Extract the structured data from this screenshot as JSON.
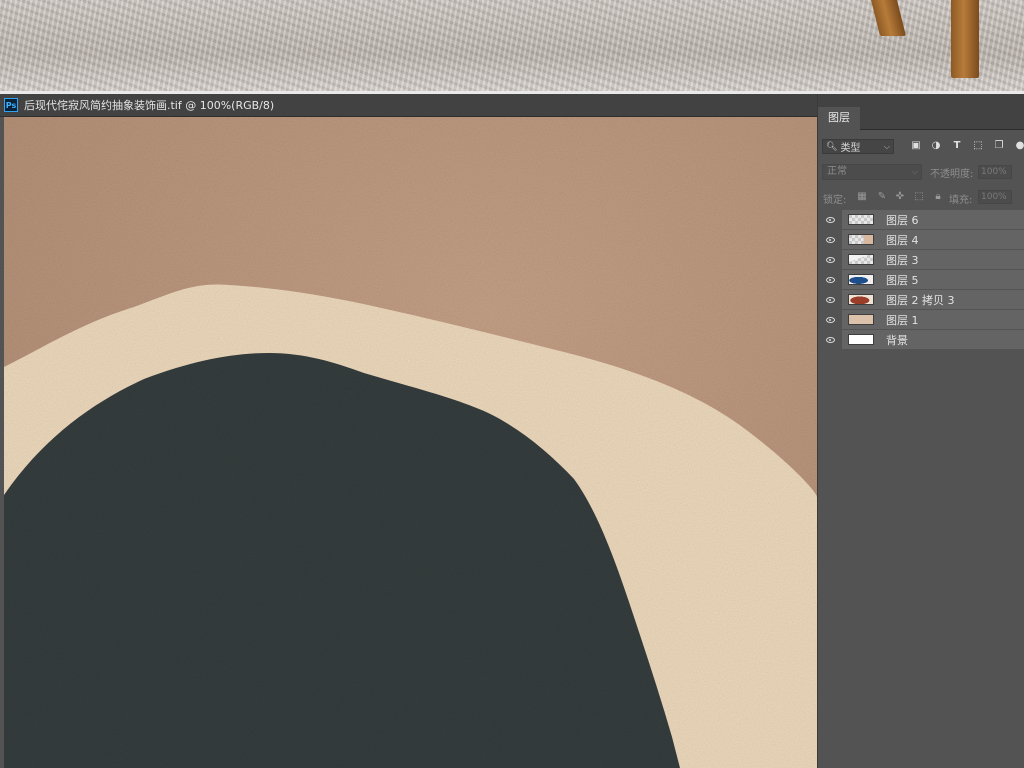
{
  "document": {
    "title": "后现代侘寂风简约抽象装饰画.tif @ 100%(RGB/8)",
    "app_icon": "Ps"
  },
  "layers_panel": {
    "tab_label": "图层",
    "filter_kind": "类型",
    "filter_icons": [
      "image-filter-icon",
      "adjustment-filter-icon",
      "type-filter-icon",
      "shape-filter-icon",
      "smart-object-filter-icon"
    ],
    "blend_mode": "正常",
    "opacity_label": "不透明度:",
    "opacity_value": "100%",
    "lock_label": "锁定:",
    "fill_label": "填充:",
    "fill_value": "100%",
    "layers": [
      {
        "name": "图层 6",
        "visible": true,
        "thumb": "transparent"
      },
      {
        "name": "图层 4",
        "visible": true,
        "thumb": "transparent-beige"
      },
      {
        "name": "图层 3",
        "visible": true,
        "thumb": "transparent-light"
      },
      {
        "name": "图层 5",
        "visible": true,
        "thumb": "blue-shape"
      },
      {
        "name": "图层 2 拷贝 3",
        "visible": true,
        "thumb": "rust-shape"
      },
      {
        "name": "图层 1",
        "visible": true,
        "thumb": "tan-fill"
      },
      {
        "name": "背景",
        "visible": true,
        "thumb": "white-fill"
      }
    ]
  },
  "colors": {
    "canvas_tan": "#b0917a",
    "canvas_cream": "#ecd9bd",
    "canvas_dark": "#33393a",
    "panel_bg": "#535353",
    "layer_row": "#646464"
  }
}
